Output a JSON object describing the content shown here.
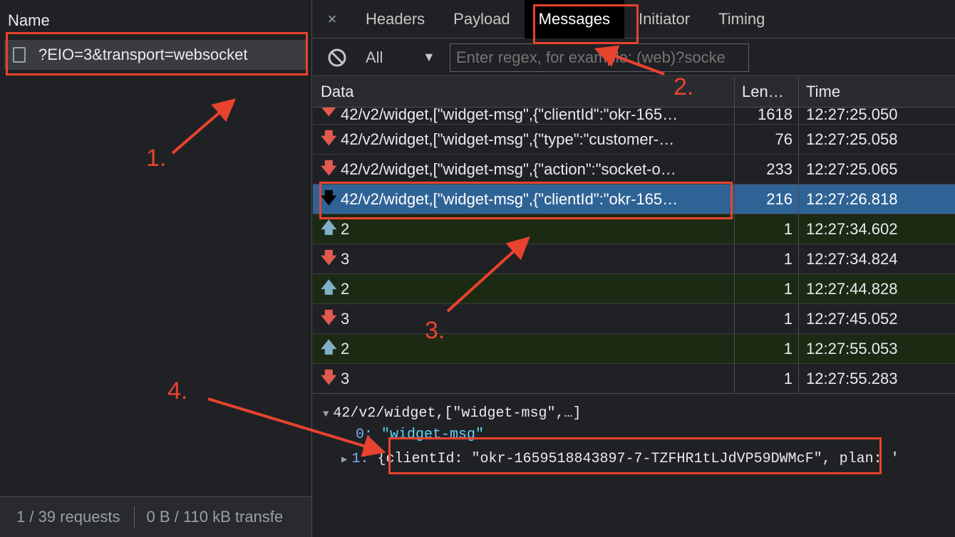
{
  "left": {
    "header": "Name",
    "request": "?EIO=3&transport=websocket",
    "status_requests": "1 / 39 requests",
    "status_transfer": "0 B / 110 kB transfe"
  },
  "tabs": {
    "close": "×",
    "items": [
      "Headers",
      "Payload",
      "Messages",
      "Initiator",
      "Timing"
    ],
    "active": "Messages"
  },
  "filter": {
    "type": "All",
    "placeholder": "Enter regex, for example: (web)?socke"
  },
  "table": {
    "headers": {
      "data": "Data",
      "length": "Len…",
      "time": "Time"
    },
    "rows": [
      {
        "dir": "down",
        "data": "42/v2/widget,[\"widget-msg\",{\"clientId\":\"okr-165…",
        "length": "1618",
        "time": "12:27:25.050"
      },
      {
        "dir": "down",
        "data": "42/v2/widget,[\"widget-msg\",{\"type\":\"customer-…",
        "length": "76",
        "time": "12:27:25.058"
      },
      {
        "dir": "down",
        "data": "42/v2/widget,[\"widget-msg\",{\"action\":\"socket-o…",
        "length": "233",
        "time": "12:27:25.065"
      },
      {
        "dir": "down",
        "data": "42/v2/widget,[\"widget-msg\",{\"clientId\":\"okr-165…",
        "length": "216",
        "time": "12:27:26.818"
      },
      {
        "dir": "up",
        "data": "2",
        "length": "1",
        "time": "12:27:34.602"
      },
      {
        "dir": "down",
        "data": "3",
        "length": "1",
        "time": "12:27:34.824"
      },
      {
        "dir": "up",
        "data": "2",
        "length": "1",
        "time": "12:27:44.828"
      },
      {
        "dir": "down",
        "data": "3",
        "length": "1",
        "time": "12:27:45.052"
      },
      {
        "dir": "up",
        "data": "2",
        "length": "1",
        "time": "12:27:55.053"
      },
      {
        "dir": "down",
        "data": "3",
        "length": "1",
        "time": "12:27:55.283"
      }
    ]
  },
  "detail": {
    "root": "42/v2/widget,[\"widget-msg\",…]",
    "item0_key": "0",
    "item0_value": "\"widget-msg\"",
    "item1_key": "1",
    "item1_open": "{",
    "item1_field": "clientId: \"okr-1659518843897-7-TZFHR1tLJdVP59DWMcF\"",
    "item1_rest": ", plan: '"
  },
  "annotations": {
    "n1": "1.",
    "n2": "2.",
    "n3": "3.",
    "n4": "4.",
    "color": "#e8432e"
  },
  "icons": {
    "down_arrow": "🡇",
    "up_arrow": "🡅",
    "block": "block-icon",
    "caret": "▼",
    "tree_open": "▼",
    "tree_closed": "▶"
  }
}
